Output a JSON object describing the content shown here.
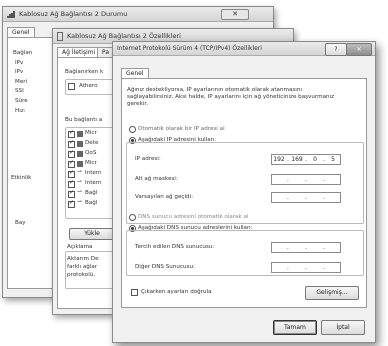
{
  "status_window": {
    "title": "Kablosuz Ağ Bağlantısı 2 Durumu",
    "tab": "Genel",
    "labels": [
      "Bağlan",
      "IPv",
      "IPv",
      "Meri",
      "SSI",
      "Süre",
      "Hız:"
    ],
    "section": "Etkinlik",
    "bottom_label": "Bay",
    "close": "✕"
  },
  "properties_window": {
    "title": "Kablosuz Ağ Bağlantısı 2 Özellikleri",
    "tabs": [
      "Ağ İletişimi",
      "Pa"
    ],
    "connect_using": "Bağlanırken k",
    "adapter": "Athero",
    "items_header": "Bu bağlantı a",
    "items": [
      "Micr",
      "Dete",
      "QoS",
      "Micr",
      "Intern",
      "Intern",
      "Bağl",
      "Bağl"
    ],
    "install_button": "Yükle",
    "description_title": "Açıklama",
    "description": [
      "Aktarım De",
      "farklı ağlar",
      "protokolü."
    ]
  },
  "ipv4_dialog": {
    "title": "Internet Protokolü Sürüm 4 (TCP/IPv4) Özellikleri",
    "help": "?",
    "close": "✕",
    "tab": "Genel",
    "description": [
      "Ağınız destekliyorsa, IP ayarlarının otomatik olarak atanmasını",
      "sağlayabilirsiniz. Aksi halde, IP ayarlarını için ağ yöneticinize başvurmanız",
      "gerekir."
    ],
    "ip_auto": "Otomatik olarak bir IP adresi al",
    "ip_manual": "Aşağıdaki IP adresini kullan:",
    "ip_address_label": "IP adresi:",
    "ip_address": [
      "192",
      "169",
      "0",
      "5"
    ],
    "subnet_label": "Alt ağ maskesi:",
    "gateway_label": "Varsayılan ağ geçidi:",
    "dns_auto": "DNS sunucu adresini otomatik olarak al",
    "dns_manual": "Aşağıdaki DNS sunucu adreslerini kullan:",
    "dns_preferred_label": "Tercih edilen DNS sunucusu:",
    "dns_alternate_label": "Diğer DNS Sunucusu:",
    "validate": "Çıkarken ayarları doğrula",
    "advanced_button": "Gelişmiş...",
    "ok_button": "Tamam",
    "cancel_button": "İptal"
  }
}
